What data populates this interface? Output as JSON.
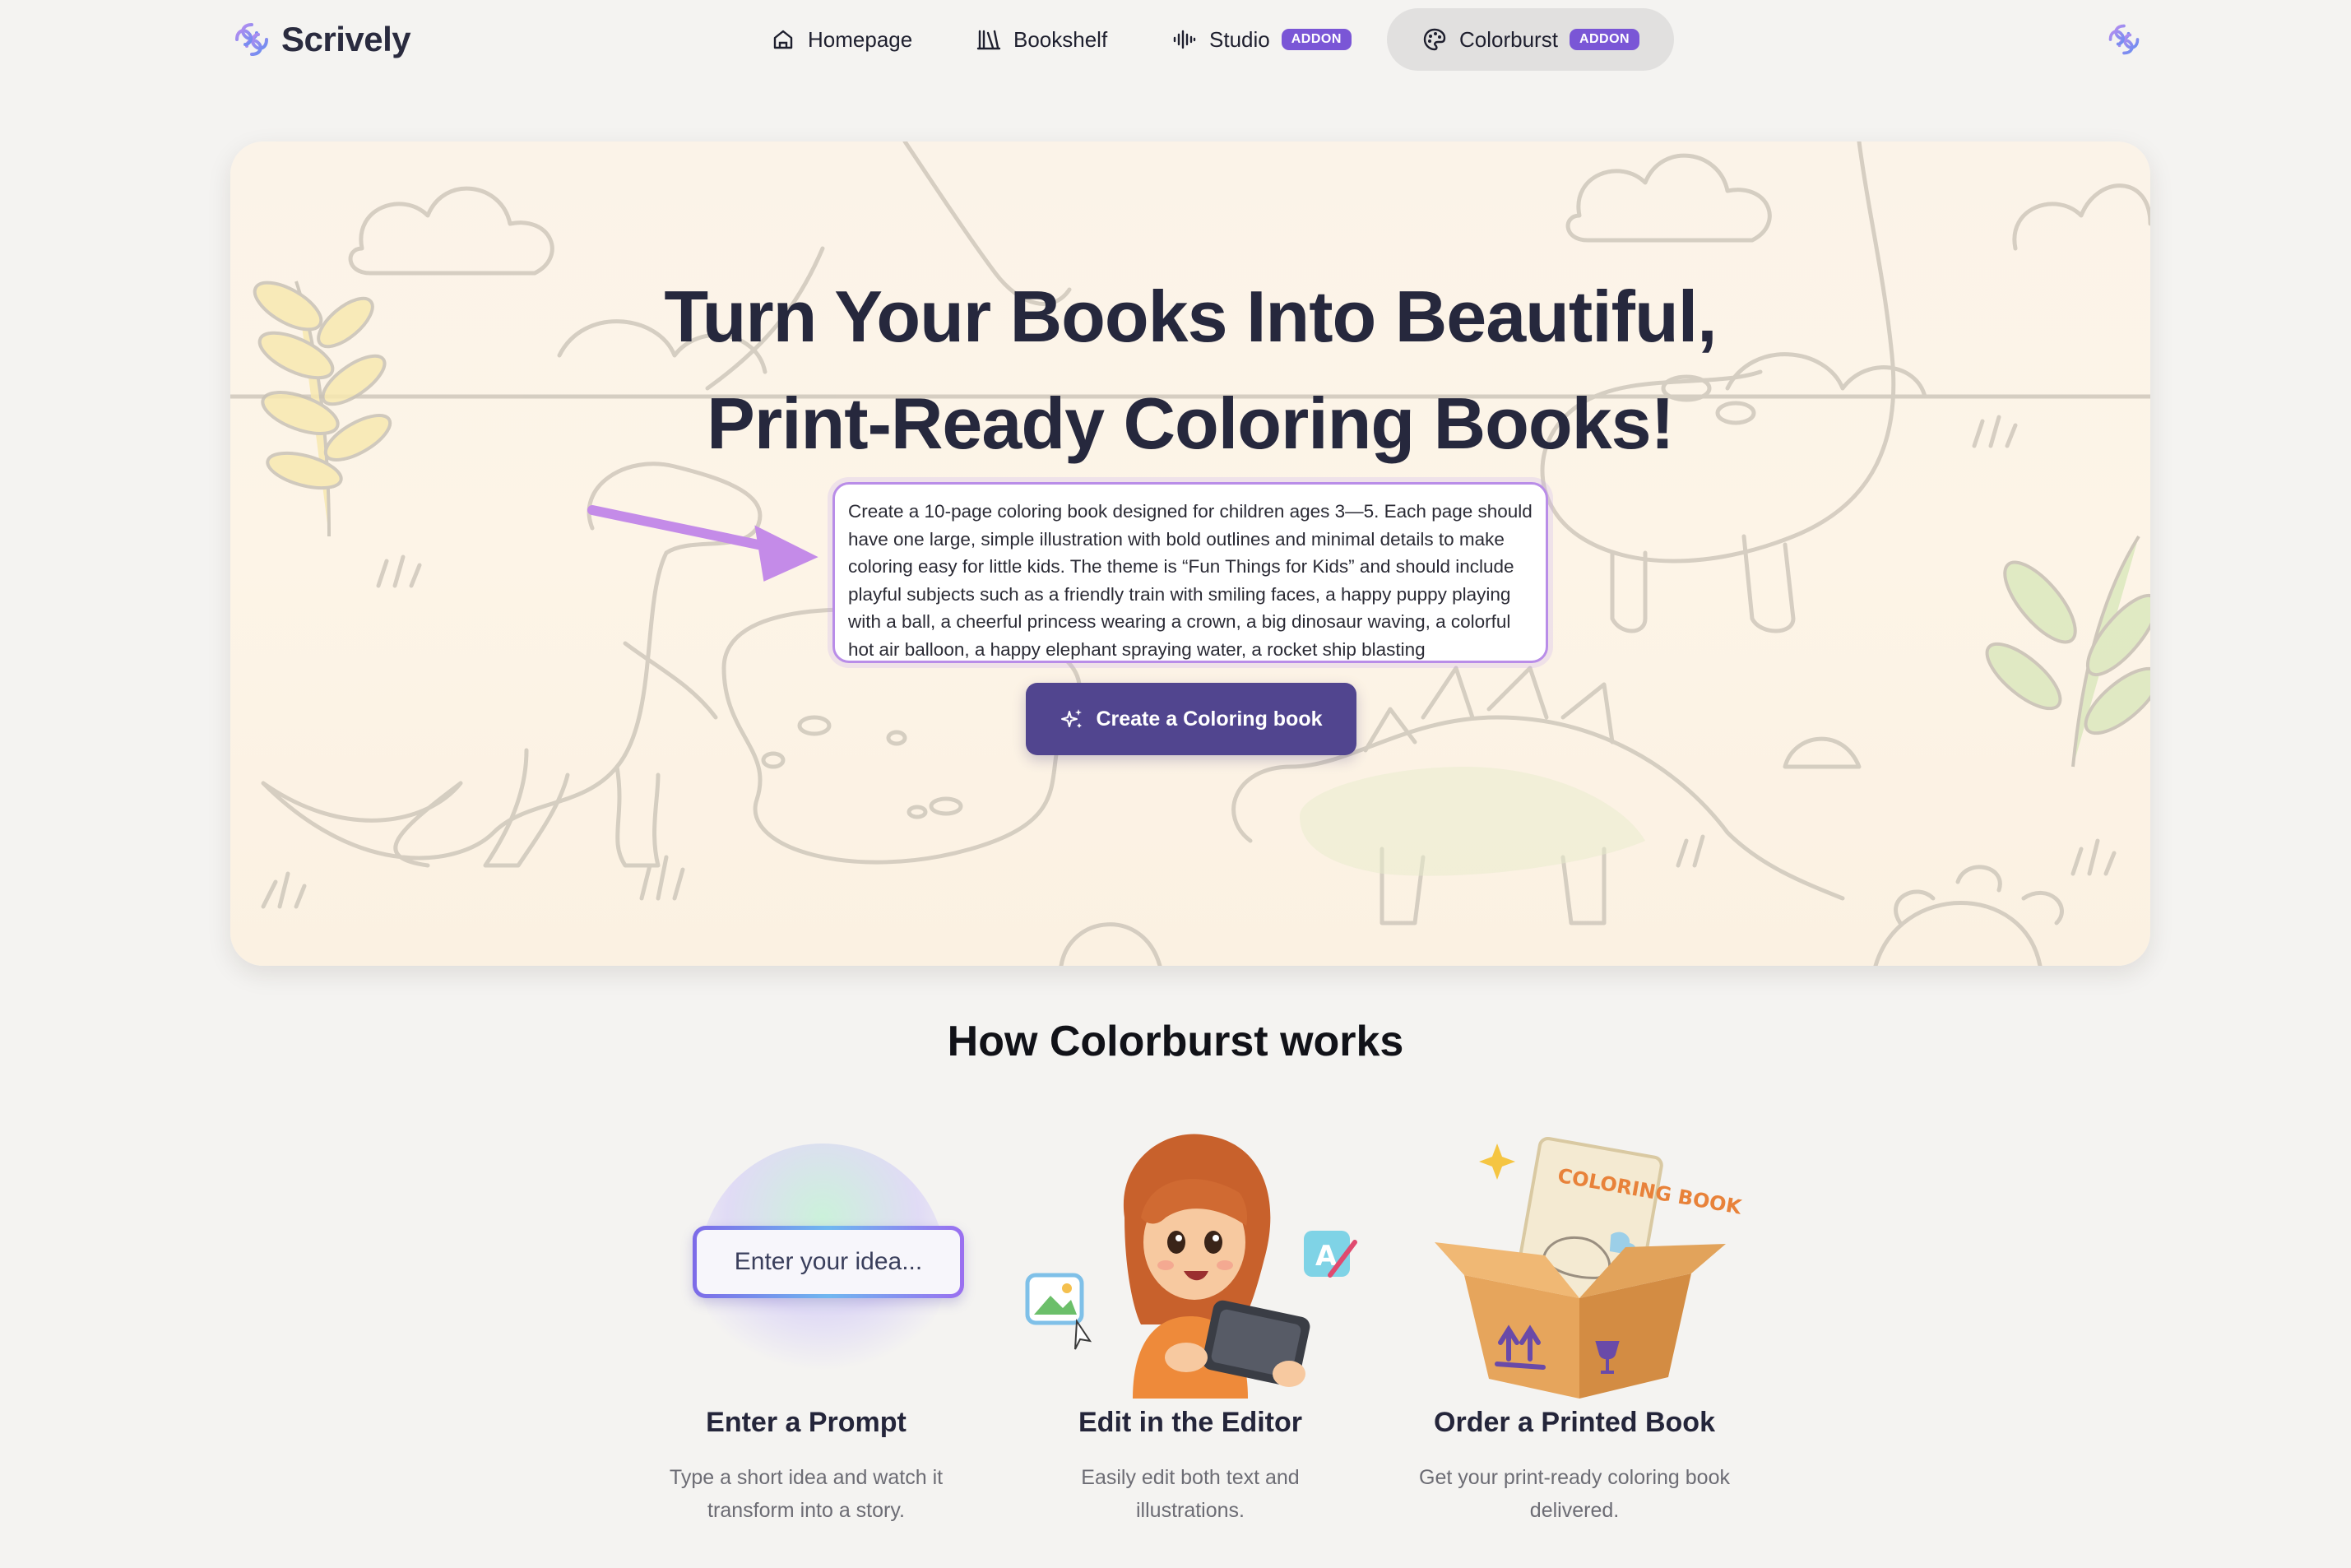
{
  "brand": {
    "name": "Scrively"
  },
  "nav": {
    "items": [
      {
        "label": "Homepage",
        "icon": "home-icon"
      },
      {
        "label": "Bookshelf",
        "icon": "bookshelf-icon"
      },
      {
        "label": "Studio",
        "icon": "audio-wave-icon",
        "badge": "ADDON"
      },
      {
        "label": "Colorburst",
        "icon": "palette-icon",
        "badge": "ADDON",
        "active": true
      }
    ]
  },
  "hero": {
    "title_line1": "Turn Your Books Into Beautiful,",
    "title_line2": "Print-Ready Coloring Books!",
    "prompt_text": "Create a 10-page coloring book designed for children ages 3—5. Each page should have one large, simple illustration with bold outlines and minimal details to make coloring easy for little kids. The theme is “Fun Things for Kids” and should include playful subjects such as a friendly train with smiling faces, a happy puppy playing with a ball, a cheerful princess wearing a crown, a big dinosaur waving, a colorful hot air balloon, a happy elephant spraying water, a rocket ship blasting",
    "create_button": "Create a Coloring book"
  },
  "how": {
    "title": "How Colorburst works",
    "steps": [
      {
        "title": "Enter a Prompt",
        "desc": "Type a short idea and watch it transform into a story.",
        "visual_text": "Enter your idea..."
      },
      {
        "title": "Edit in the Editor",
        "desc": "Easily edit both text and illustrations.",
        "visual_text": "A"
      },
      {
        "title": "Order a Printed Book",
        "desc": "Get your print-ready coloring book delivered.",
        "visual_text": "COLORING BOOK"
      }
    ]
  },
  "colors": {
    "accent": "#51458f",
    "badge": "#7a56d6",
    "background": "#f4f3f1",
    "hero_bg": "#fbf3e8"
  }
}
